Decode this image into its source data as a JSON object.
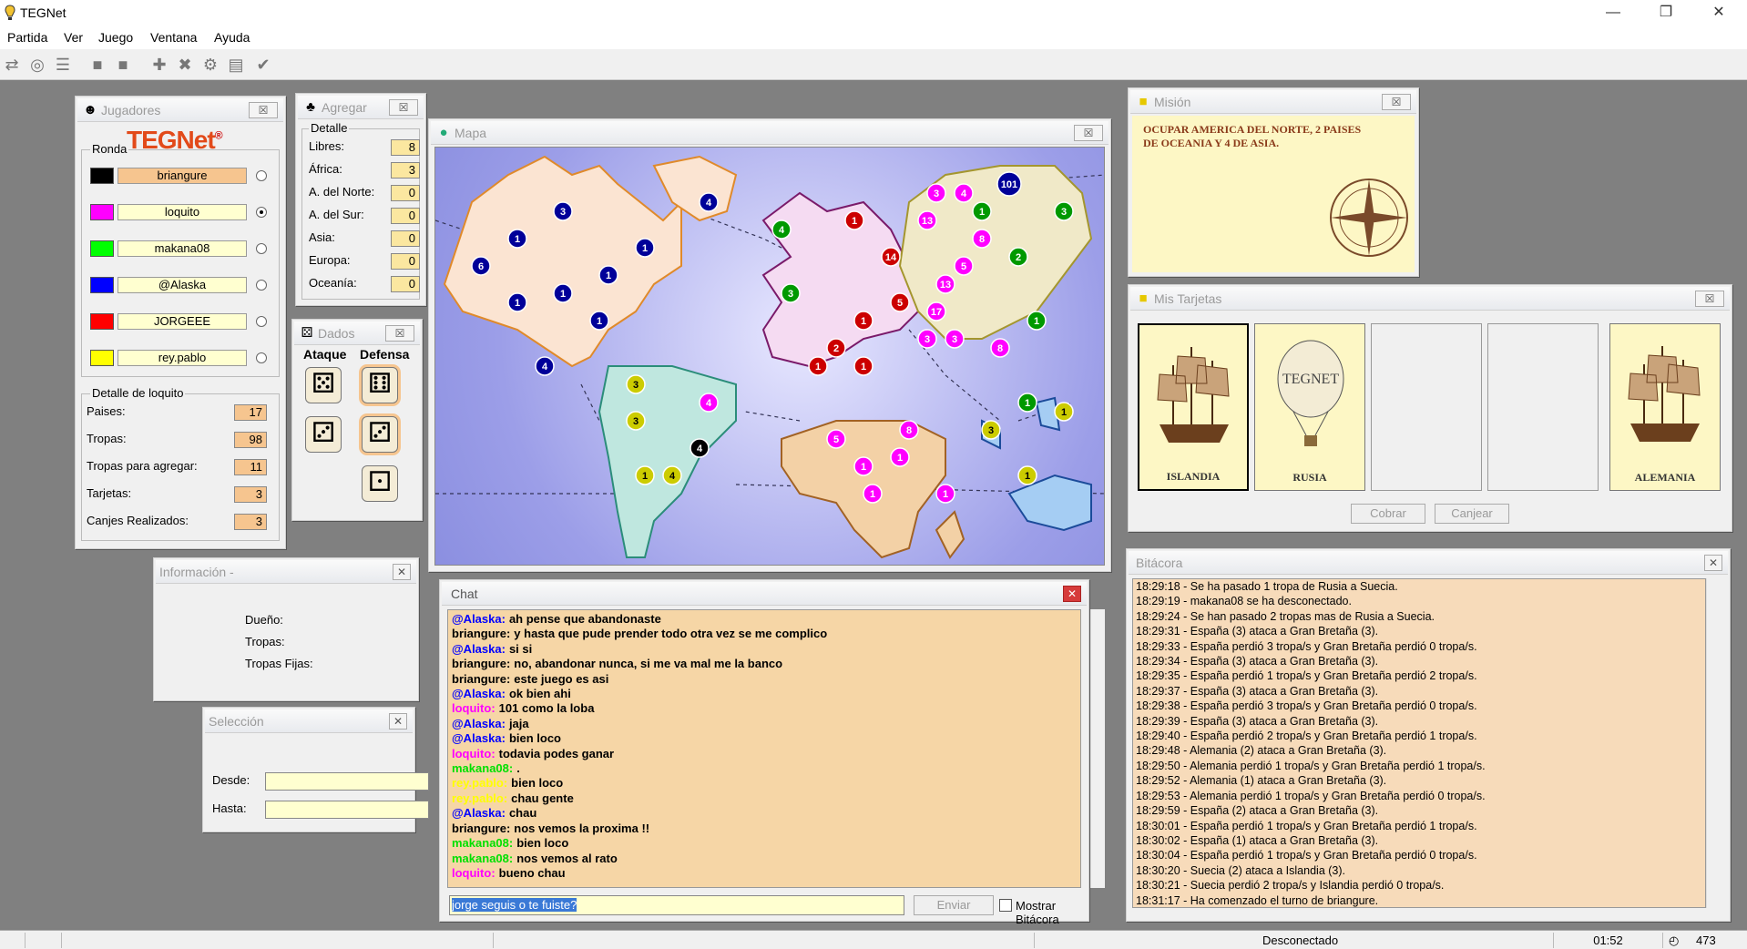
{
  "window": {
    "title": "TEGNet"
  },
  "menu": [
    "Partida",
    "Ver",
    "Juego",
    "Ventana",
    "Ayuda"
  ],
  "jugadores": {
    "title": "Jugadores",
    "logo": "TEGNet",
    "ronda_label": "Ronda",
    "players": [
      {
        "name": "briangure",
        "color": "#000000",
        "bg": "#f6c58f",
        "selected": false
      },
      {
        "name": "loquito",
        "color": "#ff00ff",
        "bg": "#ffffd0",
        "selected": true
      },
      {
        "name": "makana08",
        "color": "#00ff00",
        "bg": "#ffffd0",
        "selected": false
      },
      {
        "name": "@Alaska",
        "color": "#0000ff",
        "bg": "#ffffd0",
        "selected": false
      },
      {
        "name": "JORGEEE",
        "color": "#ff0000",
        "bg": "#ffffd0",
        "selected": false
      },
      {
        "name": "rey.pablo",
        "color": "#ffff00",
        "bg": "#ffffd0",
        "selected": false
      }
    ],
    "detalle_label": "Detalle de loquito",
    "detalle": [
      {
        "label": "Paises:",
        "value": "17"
      },
      {
        "label": "Tropas:",
        "value": "98"
      },
      {
        "label": "Tropas para agregar:",
        "value": "11"
      },
      {
        "label": "Tarjetas:",
        "value": "3"
      },
      {
        "label": "Canjes Realizados:",
        "value": "3"
      }
    ]
  },
  "agregar": {
    "title": "Agregar",
    "detalle_label": "Detalle",
    "rows": [
      {
        "label": "Libres:",
        "value": "8"
      },
      {
        "label": "África:",
        "value": "3"
      },
      {
        "label": "A. del Norte:",
        "value": "0"
      },
      {
        "label": "A. del Sur:",
        "value": "0"
      },
      {
        "label": "Asia:",
        "value": "0"
      },
      {
        "label": "Europa:",
        "value": "0"
      },
      {
        "label": "Oceanía:",
        "value": "0"
      }
    ]
  },
  "dados": {
    "title": "Dados",
    "ataque": "Ataque",
    "defensa": "Defensa"
  },
  "informacion": {
    "title": "Información -",
    "dueno": "Dueño:",
    "tropas": "Tropas:",
    "fijas": "Tropas Fijas:"
  },
  "seleccion": {
    "title": "Selección",
    "desde": "Desde:",
    "hasta": "Hasta:"
  },
  "mapa": {
    "title": "Mapa"
  },
  "mision": {
    "title": "Misión",
    "text": "OCUPAR AMERICA DEL NORTE, 2 PAISES DE OCEANIA Y 4 DE ASIA."
  },
  "tarjetas": {
    "title": "Mis Tarjetas",
    "cards": [
      "ISLANDIA",
      "RUSIA",
      "",
      "",
      "ALEMANIA"
    ],
    "cobrar": "Cobrar",
    "canjear": "Canjear"
  },
  "chat": {
    "title": "Chat",
    "input": "jorge seguis o te fuiste?",
    "enviar": "Enviar",
    "mostrar": "Mostrar Bitácora",
    "lines": [
      {
        "who": "@Alaska:",
        "color": "#0000ff",
        "msg": "ah pense que abandonaste"
      },
      {
        "who": "briangure:",
        "color": "#000000",
        "msg": "y hasta que pude prender todo otra vez se me complico"
      },
      {
        "who": "@Alaska:",
        "color": "#0000ff",
        "msg": "si si"
      },
      {
        "who": "briangure:",
        "color": "#000000",
        "msg": "no, abandonar nunca, si me va mal me la banco"
      },
      {
        "who": "briangure:",
        "color": "#000000",
        "msg": "este juego es asi"
      },
      {
        "who": "@Alaska:",
        "color": "#0000ff",
        "msg": "ok bien ahi"
      },
      {
        "who": "loquito:",
        "color": "#ff00ff",
        "msg": "101 como la loba"
      },
      {
        "who": "@Alaska:",
        "color": "#0000ff",
        "msg": "jaja"
      },
      {
        "who": "@Alaska:",
        "color": "#0000ff",
        "msg": "bien loco"
      },
      {
        "who": "loquito:",
        "color": "#ff00ff",
        "msg": "todavia podes ganar"
      },
      {
        "who": "makana08:",
        "color": "#00e000",
        "msg": "."
      },
      {
        "who": "rey.pablo:",
        "color": "#ffff00",
        "msg": "bien loco"
      },
      {
        "who": "rey.pablo:",
        "color": "#ffff00",
        "msg": "chau gente"
      },
      {
        "who": "@Alaska:",
        "color": "#0000ff",
        "msg": "chau"
      },
      {
        "who": "briangure:",
        "color": "#000000",
        "msg": "nos vemos la proxima !!"
      },
      {
        "who": "makana08:",
        "color": "#00e000",
        "msg": "bien loco"
      },
      {
        "who": "makana08:",
        "color": "#00e000",
        "msg": "nos vemos al rato"
      },
      {
        "who": "loquito:",
        "color": "#ff00ff",
        "msg": "bueno chau"
      }
    ]
  },
  "bitacora": {
    "title": "Bitácora",
    "lines": [
      "18:29:18 - Se ha pasado 1 tropa de Rusia a Suecia.",
      "18:29:19 - makana08 se ha desconectado.",
      "18:29:24 - Se han pasado 2 tropas mas de Rusia a Suecia.",
      "18:29:31 - España (3) ataca a Gran Bretaña (3).",
      "18:29:33 - España perdió 3 tropa/s y Gran Bretaña perdió 0 tropa/s.",
      "18:29:34 - España (3) ataca a Gran Bretaña (3).",
      "18:29:35 - España perdió 1 tropa/s y Gran Bretaña perdió 2 tropa/s.",
      "18:29:37 - España (3) ataca a Gran Bretaña (3).",
      "18:29:38 - España perdió 3 tropa/s y Gran Bretaña perdió 0 tropa/s.",
      "18:29:39 - España (3) ataca a Gran Bretaña (3).",
      "18:29:40 - España perdió 2 tropa/s y Gran Bretaña perdió 1 tropa/s.",
      "18:29:48 - Alemania (2) ataca a Gran Bretaña (3).",
      "18:29:50 - Alemania perdió 1 tropa/s y Gran Bretaña perdió 1 tropa/s.",
      "18:29:52 - Alemania (1) ataca a Gran Bretaña (3).",
      "18:29:53 - Alemania perdió 1 tropa/s y Gran Bretaña perdió 0 tropa/s.",
      "18:29:59 - España (2) ataca a Gran Bretaña (3).",
      "18:30:01 - España perdió 1 tropa/s y Gran Bretaña perdió 1 tropa/s.",
      "18:30:02 - España (1) ataca a Gran Bretaña (3).",
      "18:30:04 - España perdió 1 tropa/s y Gran Bretaña perdió 0 tropa/s.",
      "18:30:20 - Suecia (2) ataca a Islandia (3).",
      "18:30:21 - Suecia perdió 2 tropa/s y Islandia perdió 0 tropa/s.",
      "18:31:17 - Ha comenzado el turno de briangure."
    ]
  },
  "status": {
    "conn": "Desconectado",
    "time": "01:52",
    "count": "473"
  },
  "map_armies": [
    {
      "n": "3",
      "c": "#000099"
    },
    {
      "n": "4",
      "c": "#000099"
    },
    {
      "n": "1",
      "c": "#000099"
    },
    {
      "n": "1",
      "c": "#000099"
    },
    {
      "n": "6",
      "c": "#000099"
    },
    {
      "n": "1",
      "c": "#000099"
    },
    {
      "n": "1",
      "c": "#000099"
    },
    {
      "n": "1",
      "c": "#000099"
    },
    {
      "n": "1",
      "c": "#000099"
    },
    {
      "n": "4",
      "c": "#000099"
    },
    {
      "n": "3",
      "c": "#cccc00"
    },
    {
      "n": "4",
      "c": "#ff00ff"
    },
    {
      "n": "3",
      "c": "#cccc00"
    },
    {
      "n": "4",
      "c": "#000000"
    },
    {
      "n": "1",
      "c": "#cccc00"
    },
    {
      "n": "4",
      "c": "#cccc00"
    },
    {
      "n": "4",
      "c": "#009900"
    },
    {
      "n": "3",
      "c": "#009900"
    },
    {
      "n": "1",
      "c": "#cc0000"
    },
    {
      "n": "14",
      "c": "#cc0000"
    },
    {
      "n": "1",
      "c": "#cc0000"
    },
    {
      "n": "5",
      "c": "#cc0000"
    },
    {
      "n": "2",
      "c": "#cc0000"
    },
    {
      "n": "1",
      "c": "#cc0000"
    },
    {
      "n": "1",
      "c": "#cc0000"
    },
    {
      "n": "3",
      "c": "#ff00ff"
    },
    {
      "n": "4",
      "c": "#ff00ff"
    },
    {
      "n": "13",
      "c": "#ff00ff"
    },
    {
      "n": "101",
      "c": "#000099"
    },
    {
      "n": "1",
      "c": "#009900"
    },
    {
      "n": "3",
      "c": "#009900"
    },
    {
      "n": "8",
      "c": "#ff00ff"
    },
    {
      "n": "2",
      "c": "#009900"
    },
    {
      "n": "5",
      "c": "#ff00ff"
    },
    {
      "n": "13",
      "c": "#ff00ff"
    },
    {
      "n": "17",
      "c": "#ff00ff"
    },
    {
      "n": "3",
      "c": "#ff00ff"
    },
    {
      "n": "3",
      "c": "#ff00ff"
    },
    {
      "n": "1",
      "c": "#009900"
    },
    {
      "n": "8",
      "c": "#ff00ff"
    },
    {
      "n": "5",
      "c": "#ff00ff"
    },
    {
      "n": "8",
      "c": "#ff00ff"
    },
    {
      "n": "1",
      "c": "#ff00ff"
    },
    {
      "n": "1",
      "c": "#ff00ff"
    },
    {
      "n": "1",
      "c": "#ff00ff"
    },
    {
      "n": "1",
      "c": "#ff00ff"
    },
    {
      "n": "3",
      "c": "#cccc00"
    },
    {
      "n": "1",
      "c": "#009900"
    },
    {
      "n": "1",
      "c": "#cccc00"
    },
    {
      "n": "1",
      "c": "#cccc00"
    }
  ]
}
